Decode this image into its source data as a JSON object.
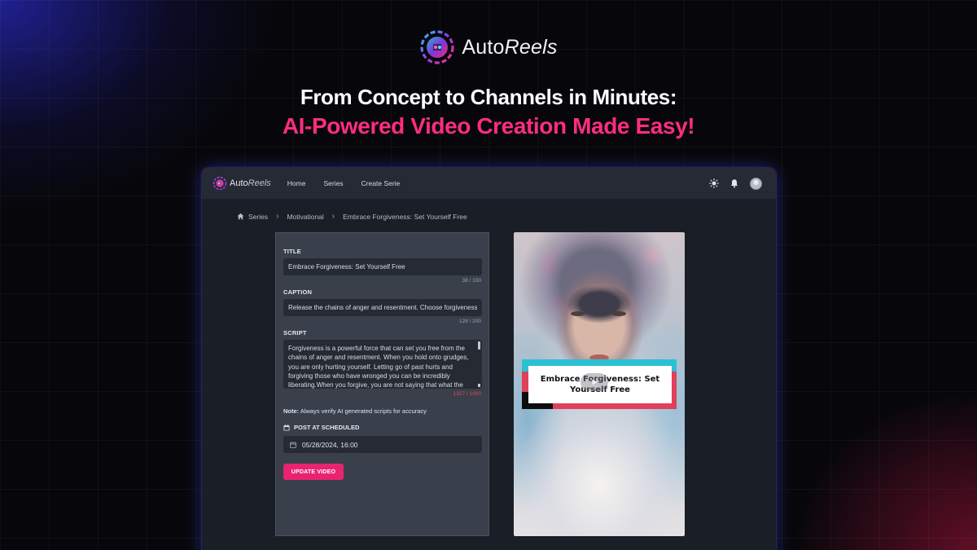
{
  "brand": {
    "name_prefix": "Auto",
    "name_suffix": "Reels",
    "logo_icon": "autoreels-logo-icon"
  },
  "hero": {
    "headline": "From Concept to Channels in Minutes:",
    "subheadline": "AI-Powered Video Creation Made Easy!"
  },
  "colors": {
    "accent_pink": "#ff2d7f",
    "button_pink": "#e8236f",
    "panel_bg": "#393f4b",
    "nav_bg": "#252a34",
    "counter_over": "#e34a57"
  },
  "app": {
    "nav": {
      "logo_prefix": "Auto",
      "logo_suffix": "Reels",
      "links": [
        "Home",
        "Series",
        "Create Serie"
      ],
      "icons": [
        "sun-icon",
        "bell-icon",
        "avatar"
      ]
    },
    "breadcrumb": [
      "Series",
      "Motivational",
      "Embrace Forgiveness: Set Yourself Free"
    ],
    "form": {
      "title_label": "TITLE",
      "title_value": "Embrace Forgiveness: Set Yourself Free",
      "title_counter": "38 / 100",
      "caption_label": "CAPTION",
      "caption_value": "Release the chains of anger and resentment. Choose forgiveness",
      "caption_counter": "128 / 200",
      "script_label": "SCRIPT",
      "script_value": "Forgiveness is a powerful force that can set you free from the chains of anger and resentment. When you hold onto grudges, you are only hurting yourself. Letting go of past hurts and forgiving those who have wronged you can be incredibly liberating.When you forgive, you are not saying that what the",
      "script_counter": "1327 / 1000",
      "note_bold": "Note:",
      "note_text": " Always verify AI generated scripts for accuracy",
      "schedule_label": "POST AT SCHEDULED",
      "schedule_value": "05/28/2024, 16:00",
      "update_button": "UPDATE VIDEO"
    },
    "preview": {
      "caption_text": "Embrace Forgiveness: Set Yourself Free"
    }
  }
}
